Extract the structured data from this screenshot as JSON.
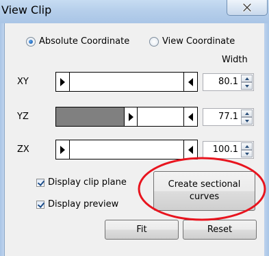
{
  "window": {
    "title": "View Clip"
  },
  "radio": [
    {
      "label": "Absolute Coordinate",
      "selected": true
    },
    {
      "label": "View Coordinate",
      "selected": false
    }
  ],
  "width_header": "Width",
  "sliders": [
    {
      "label": "XY",
      "width": "80.1",
      "position": 0
    },
    {
      "label": "YZ",
      "width": "77.1",
      "position": 0.51
    },
    {
      "label": "ZX",
      "width": "100.1",
      "position": 0
    }
  ],
  "checks": [
    {
      "label": "Display clip plane",
      "checked": true
    },
    {
      "label": "Display preview",
      "checked": true
    }
  ],
  "buttons": {
    "create_line1": "Create sectional",
    "create_line2": "curves",
    "fit": "Fit",
    "reset": "Reset"
  },
  "colors": {
    "annotation": "#e8141e",
    "slider_fill": "#808080",
    "titlebar": "#b6cfeb"
  },
  "icons": [
    "close-icon",
    "arrow-left-icon",
    "arrow-right-icon",
    "spin-up-icon",
    "spin-down-icon"
  ]
}
